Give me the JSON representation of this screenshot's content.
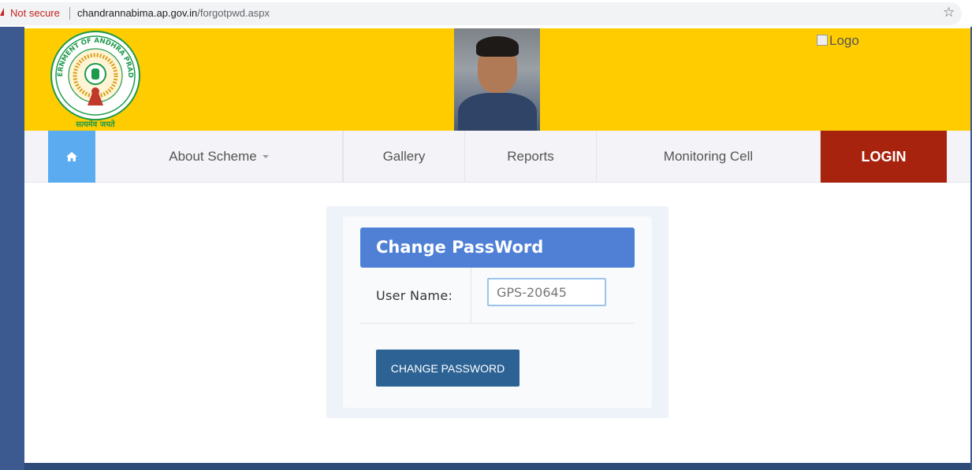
{
  "browser": {
    "security_label": "Not secure",
    "url_host": "chandrannabima.ap.gov.in",
    "url_path": "/forgotpwd.aspx"
  },
  "header": {
    "emblem_text_top": "GOVERNMENT OF ANDHRA PRADESH",
    "emblem_motto": "सत्यमेव जयते",
    "logo_alt": "Logo",
    "colors": {
      "background": "#ffcc00"
    }
  },
  "nav": {
    "items": [
      {
        "label": "About Scheme"
      },
      {
        "label": "Gallery"
      },
      {
        "label": "Reports"
      },
      {
        "label": "Monitoring Cell"
      }
    ],
    "login_label": "LOGIN",
    "colors": {
      "home": "#5aabf0",
      "login": "#a8230e"
    }
  },
  "form": {
    "title": "Change PassWord",
    "username_label": "User Name:",
    "username_value": "GPS-20645",
    "submit_label": "CHANGE PASSWORD",
    "colors": {
      "title": "#4f80d6",
      "button": "#2c6294"
    }
  }
}
